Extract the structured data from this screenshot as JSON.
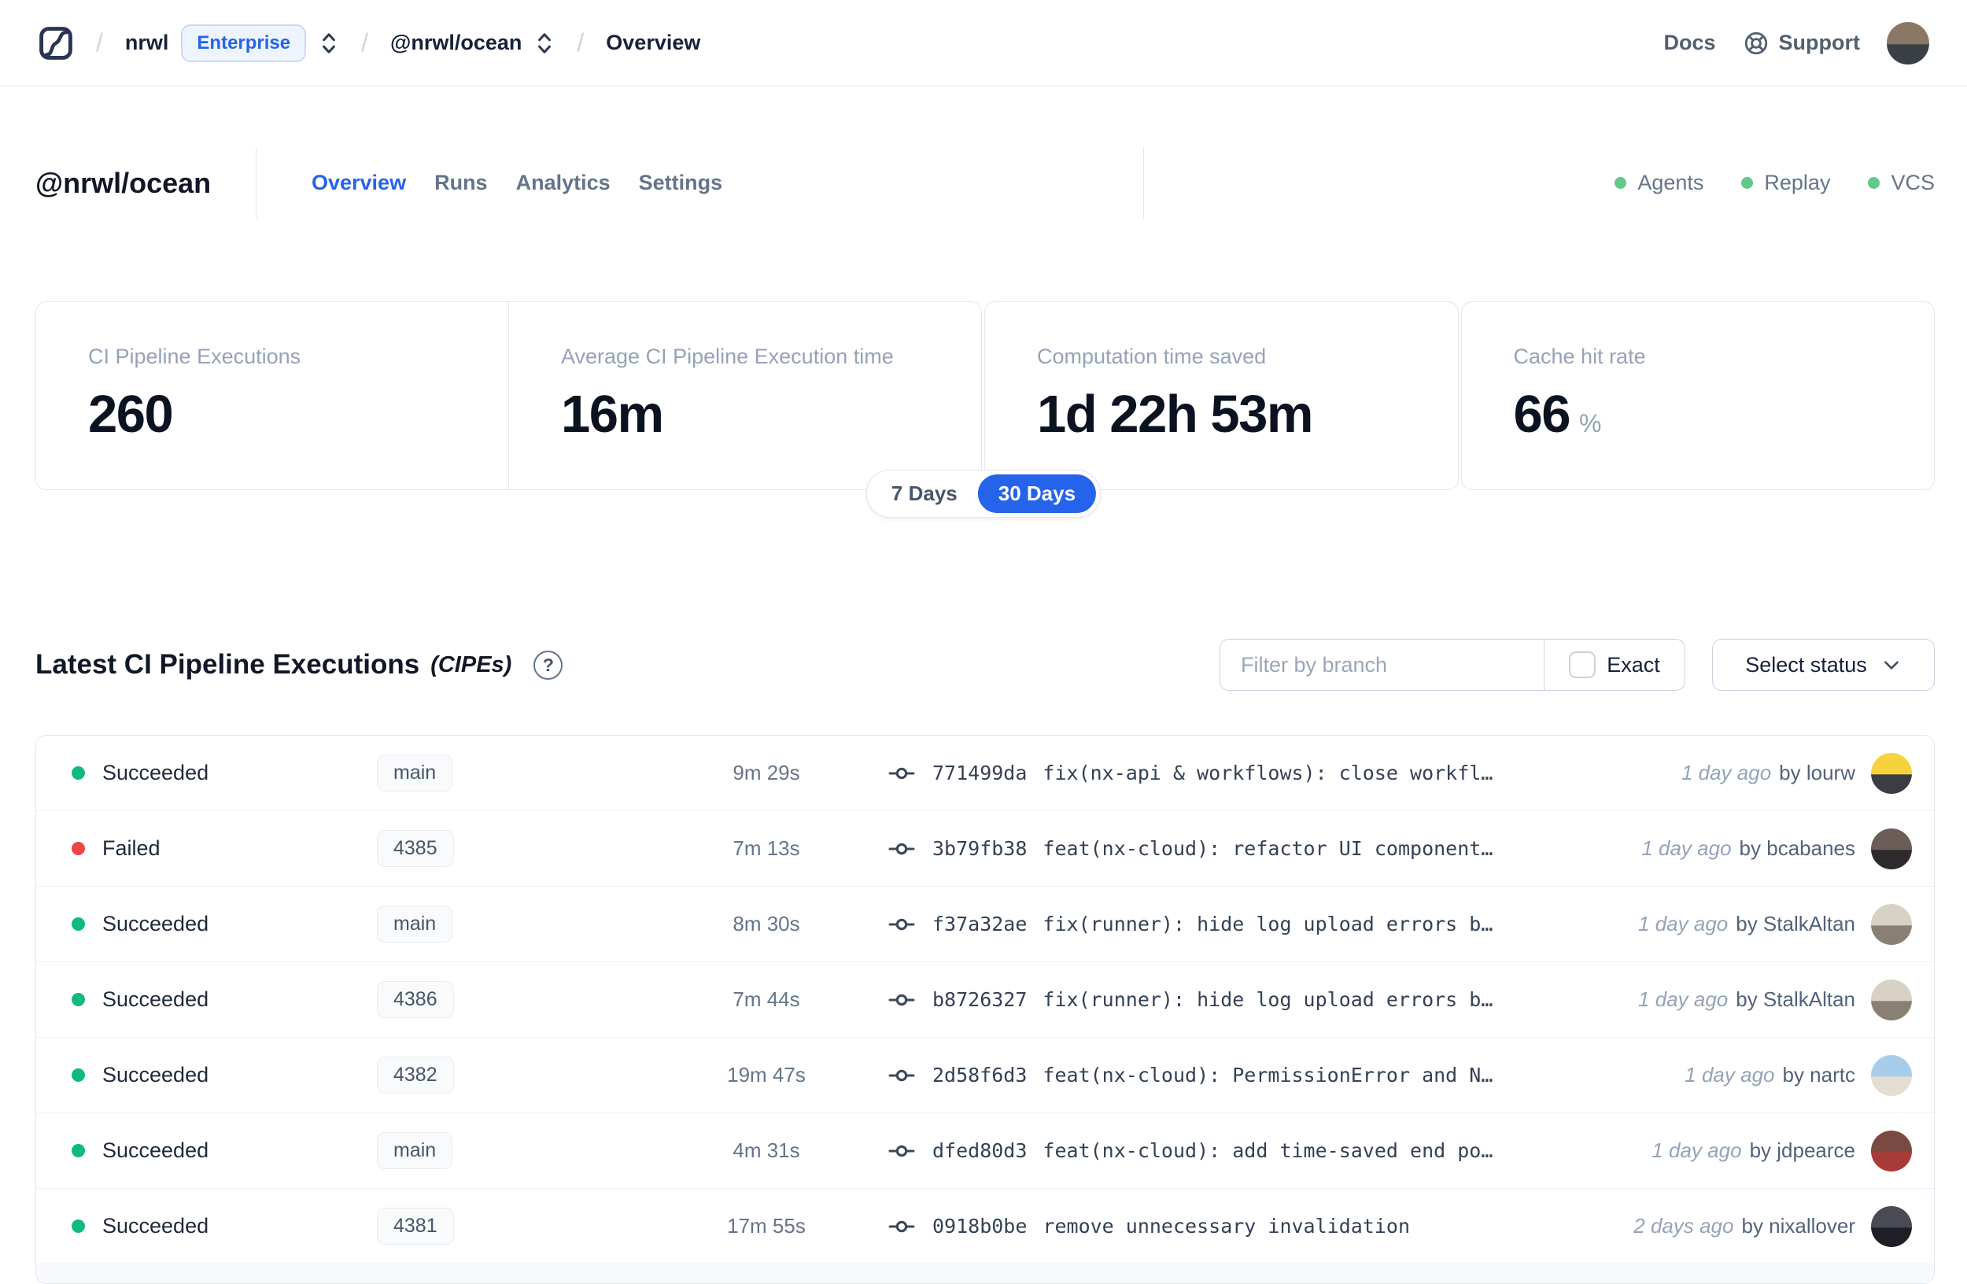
{
  "nav": {
    "separator": "/",
    "org": "nrwl",
    "org_badge": "Enterprise",
    "workspace": "@nrwl/ocean",
    "page": "Overview",
    "docs_label": "Docs",
    "support_label": "Support",
    "avatar_colors": [
      "#8a7866",
      "#3a3f45"
    ]
  },
  "header": {
    "title": "@nrwl/ocean",
    "tabs": [
      {
        "label": "Overview",
        "active": true
      },
      {
        "label": "Runs",
        "active": false
      },
      {
        "label": "Analytics",
        "active": false
      },
      {
        "label": "Settings",
        "active": false
      }
    ],
    "services": [
      {
        "label": "Agents",
        "status_color": "#63c888"
      },
      {
        "label": "Replay",
        "status_color": "#63c888"
      },
      {
        "label": "VCS",
        "status_color": "#63c888"
      }
    ]
  },
  "stats": {
    "cards": [
      {
        "label": "CI Pipeline Executions",
        "value": "260"
      },
      {
        "label": "Average CI Pipeline Execution time",
        "value": "16m"
      },
      {
        "label": "Computation time saved",
        "value": "1d 22h 53m"
      },
      {
        "label": "Cache hit rate",
        "value": "66",
        "suffix": "%"
      }
    ],
    "range_toggle": {
      "options": [
        "7 Days",
        "30 Days"
      ],
      "selected": "30 Days"
    }
  },
  "cipes": {
    "title": "Latest CI Pipeline Executions",
    "title_suffix": "(CIPEs)",
    "help_glyph": "?",
    "filter_placeholder": "Filter by branch",
    "exact_label": "Exact",
    "status_select_label": "Select status",
    "rows": [
      {
        "state": "succeeded",
        "status": "Succeeded",
        "branch": "main",
        "duration": "9m 29s",
        "commit_hash": "771499da",
        "commit_message": "fix(nx-api & workflows): close workfl…",
        "time": "1 day ago",
        "author": "by lourw",
        "avatar_colors": [
          "#f6d33c",
          "#3c3c44"
        ]
      },
      {
        "state": "failed",
        "status": "Failed",
        "branch": "4385",
        "duration": "7m 13s",
        "commit_hash": "3b79fb38",
        "commit_message": "feat(nx-cloud): refactor UI component…",
        "time": "1 day ago",
        "author": "by bcabanes",
        "avatar_colors": [
          "#6b5d57",
          "#2e2a2e"
        ]
      },
      {
        "state": "succeeded",
        "status": "Succeeded",
        "branch": "main",
        "duration": "8m 30s",
        "commit_hash": "f37a32ae",
        "commit_message": "fix(runner): hide log upload errors b…",
        "time": "1 day ago",
        "author": "by StalkAltan",
        "avatar_colors": [
          "#d8d2c6",
          "#8a7f74"
        ]
      },
      {
        "state": "succeeded",
        "status": "Succeeded",
        "branch": "4386",
        "duration": "7m 44s",
        "commit_hash": "b8726327",
        "commit_message": "fix(runner): hide log upload errors b…",
        "time": "1 day ago",
        "author": "by StalkAltan",
        "avatar_colors": [
          "#d8d2c6",
          "#8a7f74"
        ]
      },
      {
        "state": "succeeded",
        "status": "Succeeded",
        "branch": "4382",
        "duration": "19m 47s",
        "commit_hash": "2d58f6d3",
        "commit_message": "feat(nx-cloud): PermissionError and N…",
        "time": "1 day ago",
        "author": "by nartc",
        "avatar_colors": [
          "#a8cdea",
          "#e3ddd2"
        ]
      },
      {
        "state": "succeeded",
        "status": "Succeeded",
        "branch": "main",
        "duration": "4m 31s",
        "commit_hash": "dfed80d3",
        "commit_message": "feat(nx-cloud): add time-saved end po…",
        "time": "1 day ago",
        "author": "by jdpearce",
        "avatar_colors": [
          "#7a4a42",
          "#a83a3a"
        ]
      },
      {
        "state": "succeeded",
        "status": "Succeeded",
        "branch": "4381",
        "duration": "17m 55s",
        "commit_hash": "0918b0be",
        "commit_message": "remove unnecessary invalidation",
        "time": "2 days ago",
        "author": "by nixallover",
        "avatar_colors": [
          "#4a4a55",
          "#1f1f28"
        ]
      }
    ]
  },
  "colors": {
    "accent": "#2563eb",
    "success": "#10b981",
    "failure": "#ef4444",
    "border": "#e2e8f0"
  }
}
